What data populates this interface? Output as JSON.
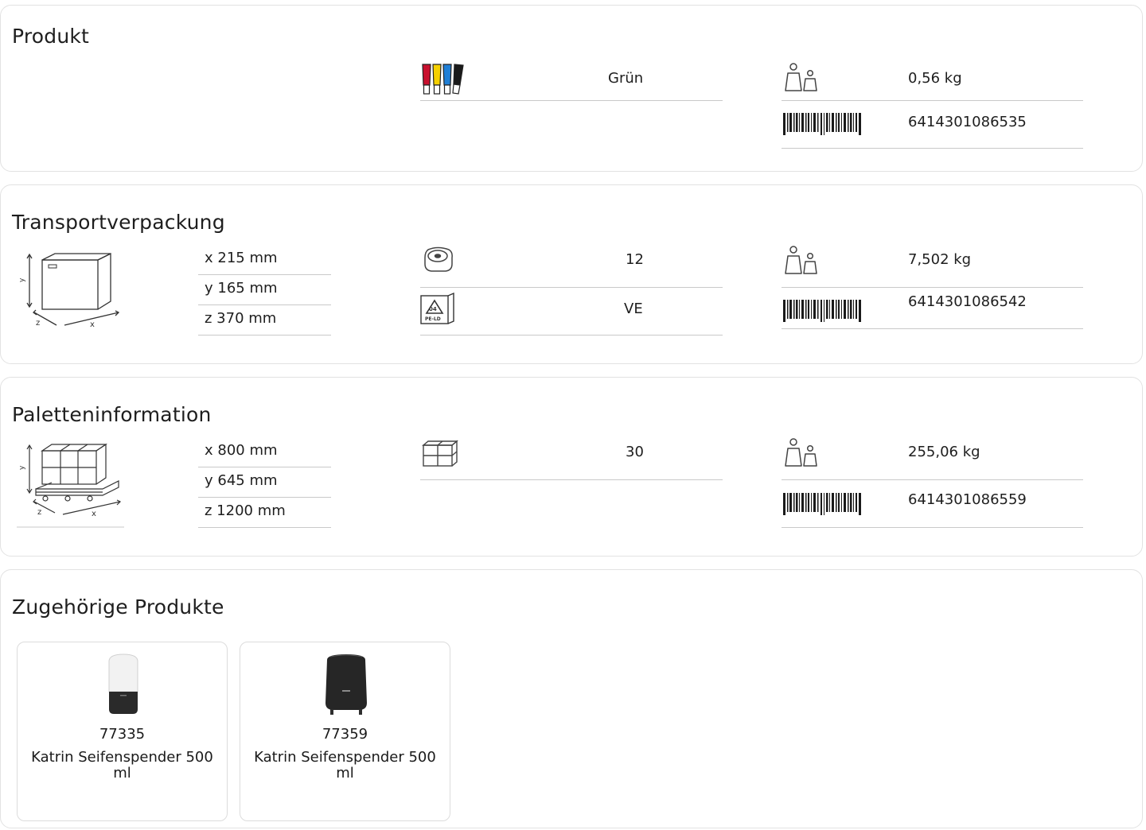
{
  "produkt": {
    "title": "Produkt",
    "color_value": "Grün",
    "weight_value": "0,56 kg",
    "ean_value": "6414301086535"
  },
  "transport": {
    "title": "Transportverpackung",
    "dims": [
      "x 215 mm",
      "y 165 mm",
      "z 370 mm"
    ],
    "count_value": "12",
    "pack_value": "VE",
    "weight_value": "7,502 kg",
    "ean_value": "6414301086542",
    "recycle_label_top": "04",
    "recycle_label_bottom": "PE-LD"
  },
  "pallet": {
    "title": "Paletteninformation",
    "dims": [
      "x 800 mm",
      "y 645 mm",
      "z 1200 mm"
    ],
    "count_value": "30",
    "weight_value": "255,06 kg",
    "ean_value": "6414301086559"
  },
  "related": {
    "title": "Zugehörige Produkte",
    "items": [
      {
        "number": "77335",
        "name": "Katrin Seifenspender 500 ml",
        "variant": "white-black"
      },
      {
        "number": "77359",
        "name": "Katrin Seifenspender 500 ml",
        "variant": "black"
      }
    ]
  },
  "icons": [
    "color-swatch-icon",
    "weight-icon",
    "barcode-icon",
    "box-dimensions-icon",
    "roll-icon",
    "recycling-icon",
    "pallet-dimensions-icon",
    "boxes-icon",
    "dispenser-image"
  ],
  "colors": {
    "swatch": [
      "#c8102e",
      "#f5d000",
      "#1f7fd6",
      "#1a1a1a"
    ],
    "border": "#e2e2e2",
    "rule": "#c9c9c9"
  }
}
